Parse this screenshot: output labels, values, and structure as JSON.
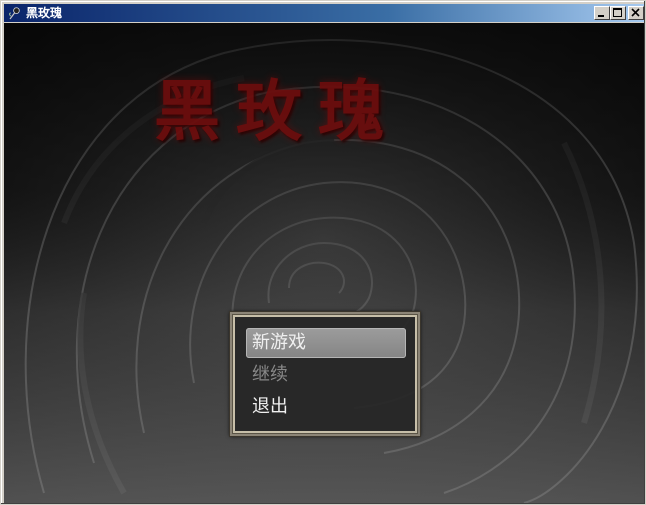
{
  "window": {
    "title": "黑玫瑰",
    "app_icon": "rose-icon",
    "controls": [
      "minimize-icon",
      "maximize-icon",
      "close-icon"
    ]
  },
  "game": {
    "title": "黑玫瑰",
    "title_color": "#6e0d0d",
    "background": "black-rose-image"
  },
  "menu": {
    "items": [
      {
        "label": "新游戏",
        "state": "selected"
      },
      {
        "label": "继续",
        "state": "disabled"
      },
      {
        "label": "退出",
        "state": "normal"
      }
    ]
  }
}
